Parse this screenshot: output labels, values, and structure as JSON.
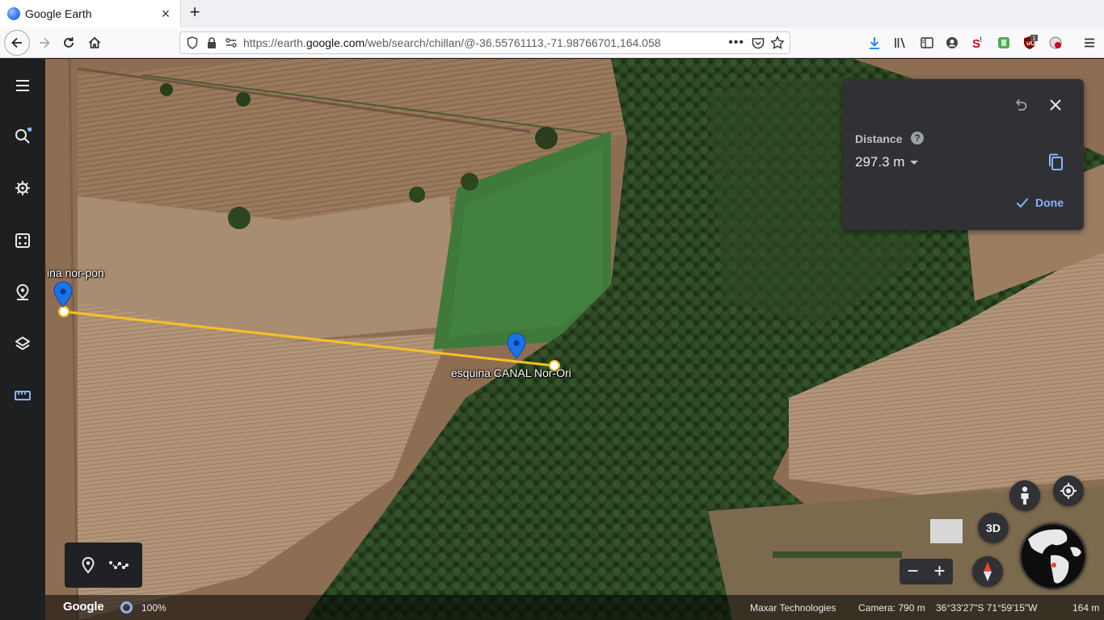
{
  "browser": {
    "tab_title": "Google Earth",
    "url_prefix": "https://earth.",
    "url_domain": "google.com",
    "url_rest": "/web/search/chillan/@-36.55761113,-71.98766701,164.058",
    "toolbar_badge": "1"
  },
  "sidebar": {
    "items": [
      "menu-icon",
      "search-icon",
      "voyager-icon",
      "feeling-lucky-icon",
      "projects-icon",
      "map-style-icon",
      "measure-icon"
    ]
  },
  "map": {
    "placemarks": [
      {
        "label": "ina nor-pon"
      },
      {
        "label": "esquina CANAL Nor-Ori"
      }
    ],
    "measure_line_color": "#f9c023"
  },
  "distance_panel": {
    "label": "Distance",
    "help": "?",
    "value": "297.3 m",
    "done_label": "Done"
  },
  "controls": {
    "btn_3d": "3D",
    "zoom_out": "−",
    "zoom_in": "+"
  },
  "status": {
    "logo": "Google",
    "loading": "100%",
    "attribution": "Maxar Technologies",
    "camera": "Camera: 790 m",
    "coords": "36°33'27\"S 71°59'15\"W",
    "scale": "164 m"
  },
  "colors": {
    "accent": "#8ab4f8",
    "panel_bg": "#303134",
    "sidebar_bg": "#1e1f21",
    "pin_blue": "#1a73e8"
  }
}
